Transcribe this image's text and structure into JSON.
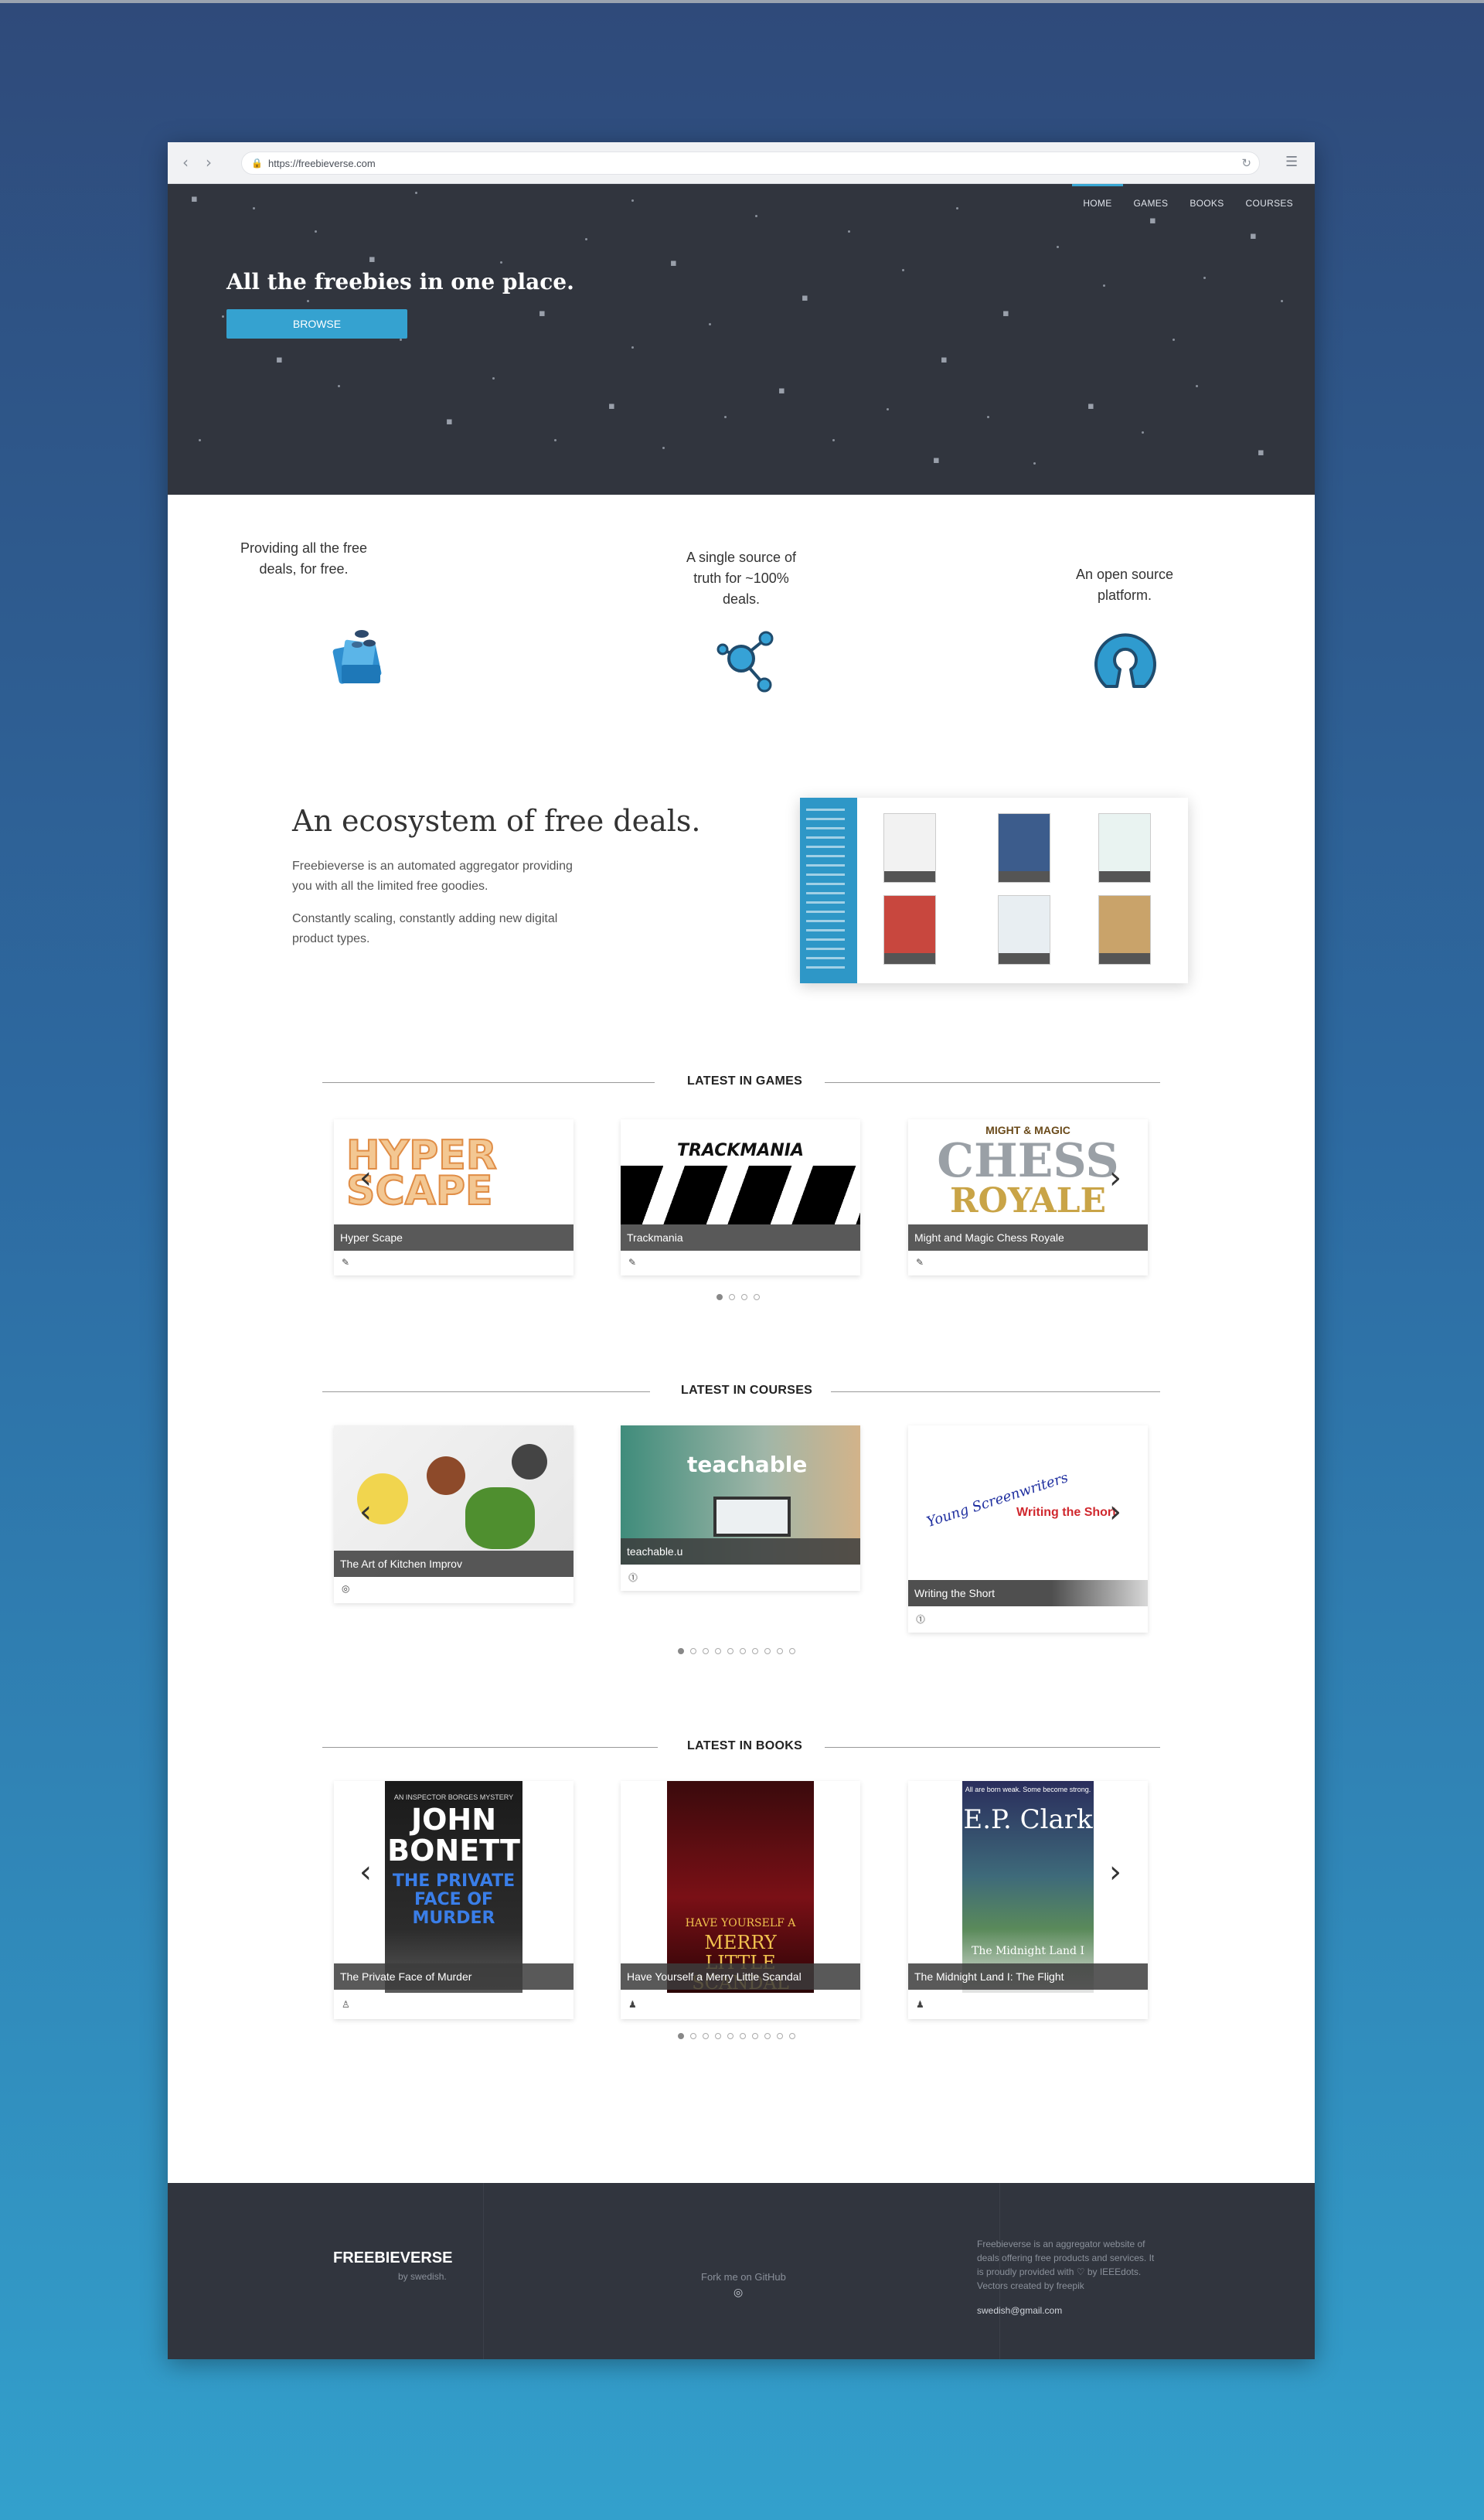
{
  "browser": {
    "url": "https://freebieverse.com",
    "back_icon": "‹",
    "forward_icon": "›",
    "lock_icon": "🔒",
    "reload_icon": "↻",
    "menu_icon": "☰"
  },
  "nav": {
    "items": [
      "HOME",
      "GAMES",
      "BOOKS",
      "COURSES"
    ],
    "active": "HOME"
  },
  "hero": {
    "title": "All the freebies in one place.",
    "browse_label": "BROWSE"
  },
  "features": [
    {
      "text": "Providing all the free deals, for free.",
      "icon": "wallet-coins-icon"
    },
    {
      "text": "A single source of truth for ~100% deals.",
      "icon": "network-nodes-icon"
    },
    {
      "text": "An open source platform.",
      "icon": "open-source-icon"
    }
  ],
  "ecosystem": {
    "title": "An ecosystem of free deals.",
    "p1": "Freebieverse is an automated aggregator providing you with all the limited free goodies.",
    "p2": "Constantly scaling, constantly adding new digital product types."
  },
  "games": {
    "heading": "LATEST IN GAMES",
    "cards": [
      {
        "title": "Hyper Scape",
        "art": "HYPER SCAPE"
      },
      {
        "title": "Trackmania",
        "art": "TRACKMANIA"
      },
      {
        "title": "Might and Magic Chess Royale",
        "art_top": "MIGHT & MAGIC",
        "art": "CHESS",
        "art2": "ROYALE"
      }
    ],
    "dots": 4,
    "active_dot": 0
  },
  "courses": {
    "heading": "LATEST IN COURSES",
    "cards": [
      {
        "title": "The Art of Kitchen Improv"
      },
      {
        "title": "teachable.u",
        "art": "teachable"
      },
      {
        "title": "Writing the Short",
        "art": "Young Screenwriters",
        "art2": "Writing the Short"
      }
    ],
    "dots": 10,
    "active_dot": 0
  },
  "books": {
    "heading": "LATEST IN BOOKS",
    "cards": [
      {
        "title": "The Private Face of Murder",
        "art_top": "AN INSPECTOR BORGES MYSTERY",
        "art": "JOHN BONETT",
        "art2": "THE PRIVATE FACE OF MURDER"
      },
      {
        "title": "Have Yourself a Merry Little Scandal",
        "art": "HAVE YOURSELF A",
        "art2": "MERRY LITTLE SCANDAL"
      },
      {
        "title": "The Midnight Land I: The Flight",
        "art_top": "All are born weak. Some become strong.",
        "art": "E.P. Clark",
        "art2": "The Midnight Land I"
      }
    ],
    "dots": 10,
    "active_dot": 0
  },
  "footer": {
    "brand": "FREEBIEVERSE",
    "by": "by swedish.",
    "fork": "Fork me on GitHub",
    "github_icon": "◎",
    "about": "Freebieverse is an aggregator website of deals offering free products and services. It is proudly provided with ♡ by IEEEdots. Vectors created by freepik",
    "email": "swedish@gmail.com"
  },
  "colors": {
    "accent": "#35a2d0",
    "hero_bg": "#31353e",
    "footer_bg": "#31353e"
  }
}
